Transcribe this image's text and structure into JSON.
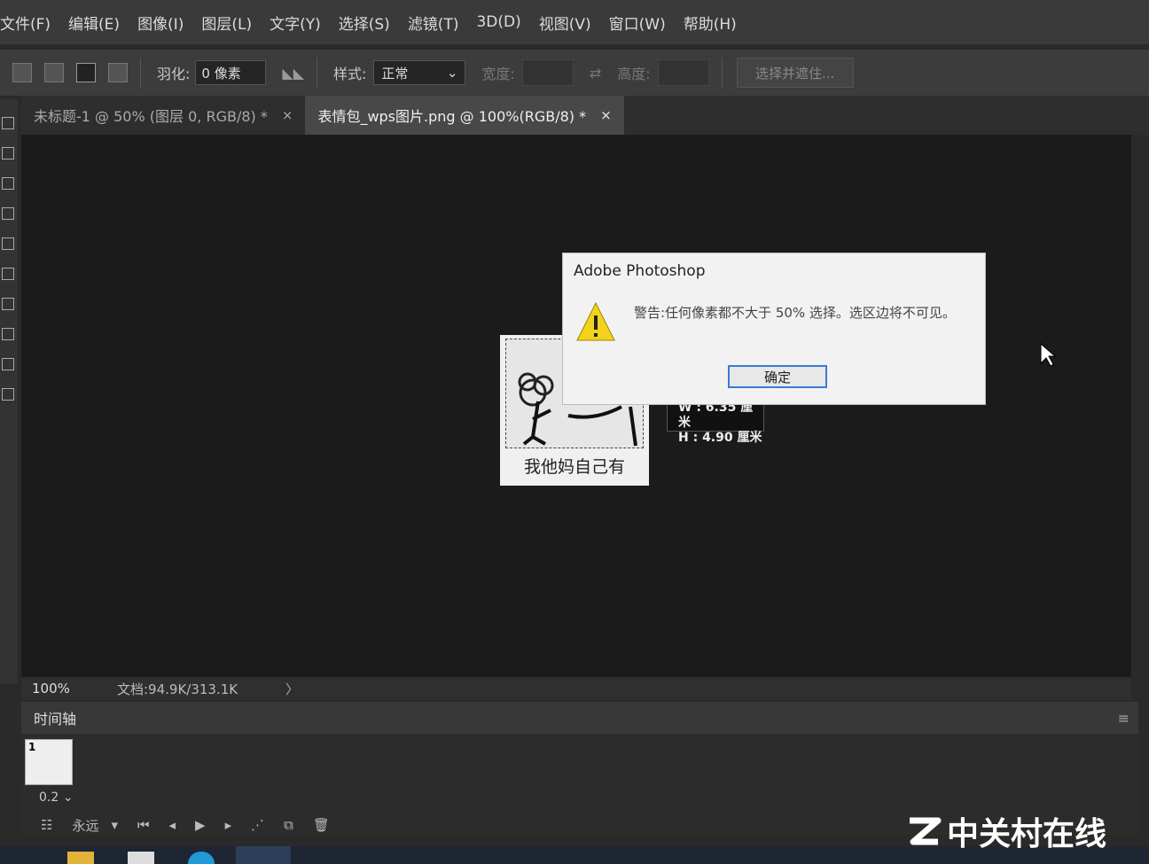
{
  "menubar": {
    "items": [
      "文件(F)",
      "编辑(E)",
      "图像(I)",
      "图层(L)",
      "文字(Y)",
      "选择(S)",
      "滤镜(T)",
      "3D(D)",
      "视图(V)",
      "窗口(W)",
      "帮助(H)"
    ]
  },
  "options": {
    "feather_label": "羽化:",
    "feather_value": "0 像素",
    "style_label": "样式:",
    "style_value": "正常",
    "width_label": "宽度:",
    "height_label": "高度:",
    "select_mask_label": "选择并遮住..."
  },
  "tabs": [
    {
      "label": "未标题-1 @ 50% (图层 0, RGB/8) *",
      "close": "×"
    },
    {
      "label": "表情包_wps图片.png @ 100%(RGB/8) *",
      "close": "×"
    }
  ],
  "document": {
    "caption": "我他妈自己有"
  },
  "dimension_tip": {
    "w": "W : 6.35 厘米",
    "h": "H : 4.90 厘米"
  },
  "dialog": {
    "title": "Adobe Photoshop",
    "message": "警告:任何像素都不大于 50% 选择。选区边将不可见。",
    "ok_label": "确定"
  },
  "statusbar": {
    "zoom": "100%",
    "doc_info": "文档:94.9K/313.1K",
    "arrow": "〉"
  },
  "timeline": {
    "title": "时间轴",
    "frame_number": "1",
    "frame_delay": "0.2",
    "loop_label": "永远"
  },
  "watermark": {
    "text": "中关村在线"
  },
  "colors": {
    "accent": "#3b7bd6",
    "warning": "#f2d21b"
  }
}
